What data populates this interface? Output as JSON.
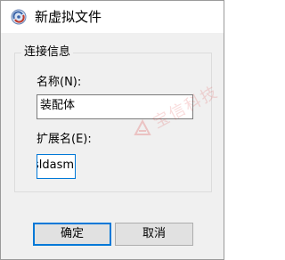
{
  "window": {
    "title": "新虚拟文件"
  },
  "group": {
    "legend": "连接信息"
  },
  "name_field": {
    "label": "名称(N):",
    "value": "装配体"
  },
  "ext_field": {
    "label": "扩展名(E):",
    "value": ".sldasm"
  },
  "buttons": {
    "ok": "确定",
    "cancel": "取消"
  },
  "watermark": {
    "text": "宝信科技"
  },
  "colors": {
    "accent": "#0078d7",
    "dialog_bg": "#f0f0f0",
    "button_bg": "#e1e1e1"
  }
}
